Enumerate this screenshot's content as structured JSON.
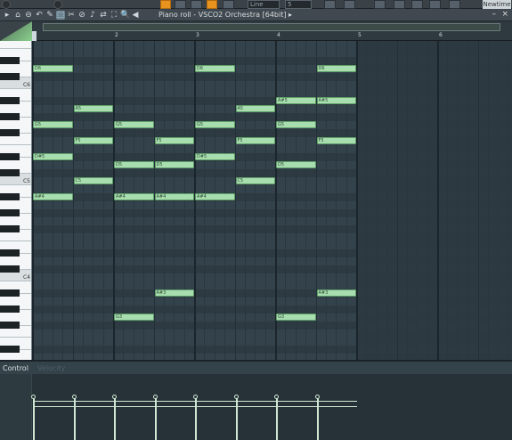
{
  "toolbar": {
    "title": "Piano roll - VSCO2 Orchestra [64bit]",
    "title_arrow": "▸",
    "snap_value": "Line",
    "step_value": "5",
    "newtime_label": "Newtime",
    "min_glyph": "–",
    "close_glyph": "×"
  },
  "tools": [
    "▸",
    "⌂",
    "⊖",
    "↶",
    "✎",
    "⬚",
    "✂",
    "⊘",
    "♪",
    "⇄",
    "⛶",
    "🔍",
    "◀"
  ],
  "ruler": {
    "marks": [
      {
        "label": "2",
        "bar": 2
      },
      {
        "label": "3",
        "bar": 3
      },
      {
        "label": "4",
        "bar": 4
      },
      {
        "label": "5",
        "bar": 5
      },
      {
        "label": "6",
        "bar": 6
      }
    ]
  },
  "keyboard": {
    "labels": [
      "C6",
      "C5",
      "C4"
    ]
  },
  "notes": [
    {
      "label": "D6",
      "pitch": "D6",
      "start": 0,
      "len": 1
    },
    {
      "label": "D6",
      "pitch": "D6",
      "start": 4,
      "len": 1
    },
    {
      "label": "D6",
      "pitch": "D6",
      "start": 7,
      "len": 1
    },
    {
      "label": "A#5",
      "pitch": "A#5",
      "start": 6,
      "len": 1
    },
    {
      "label": "A#5",
      "pitch": "A#5",
      "start": 7,
      "len": 1
    },
    {
      "label": "A5",
      "pitch": "A5",
      "start": 1,
      "len": 1
    },
    {
      "label": "A5",
      "pitch": "A5",
      "start": 5,
      "len": 1
    },
    {
      "label": "G5",
      "pitch": "G5",
      "start": 0,
      "len": 1
    },
    {
      "label": "G5",
      "pitch": "G5",
      "start": 2,
      "len": 1
    },
    {
      "label": "G5",
      "pitch": "G5",
      "start": 4,
      "len": 1
    },
    {
      "label": "G5",
      "pitch": "G5",
      "start": 6,
      "len": 1
    },
    {
      "label": "F5",
      "pitch": "F5",
      "start": 1,
      "len": 1
    },
    {
      "label": "F5",
      "pitch": "F5",
      "start": 3,
      "len": 1
    },
    {
      "label": "F5",
      "pitch": "F5",
      "start": 5,
      "len": 1
    },
    {
      "label": "F5",
      "pitch": "F5",
      "start": 7,
      "len": 1
    },
    {
      "label": "D#5",
      "pitch": "D#5",
      "start": 0,
      "len": 1
    },
    {
      "label": "D#5",
      "pitch": "D#5",
      "start": 4,
      "len": 1
    },
    {
      "label": "D5",
      "pitch": "D5",
      "start": 2,
      "len": 1
    },
    {
      "label": "D5",
      "pitch": "D5",
      "start": 3,
      "len": 1
    },
    {
      "label": "D5",
      "pitch": "D5",
      "start": 6,
      "len": 1
    },
    {
      "label": "C5",
      "pitch": "C5",
      "start": 1,
      "len": 1
    },
    {
      "label": "C5",
      "pitch": "C5",
      "start": 5,
      "len": 1
    },
    {
      "label": "A#4",
      "pitch": "A#4",
      "start": 0,
      "len": 1
    },
    {
      "label": "A#4",
      "pitch": "A#4",
      "start": 2,
      "len": 1
    },
    {
      "label": "A#4",
      "pitch": "A#4",
      "start": 3,
      "len": 1
    },
    {
      "label": "A#4",
      "pitch": "A#4",
      "start": 4,
      "len": 1
    },
    {
      "label": "A#3",
      "pitch": "A#3",
      "start": 3,
      "len": 1
    },
    {
      "label": "A#3",
      "pitch": "A#3",
      "start": 7,
      "len": 1
    },
    {
      "label": "G3",
      "pitch": "G3",
      "start": 2,
      "len": 1
    },
    {
      "label": "G3",
      "pitch": "G3",
      "start": 6,
      "len": 1
    }
  ],
  "control": {
    "label": "Control",
    "target": "Velocity"
  },
  "colors": {
    "note_fill": "#a8ddb0",
    "accent_orange": "#e8931d",
    "grid_bg": "#34434b"
  }
}
